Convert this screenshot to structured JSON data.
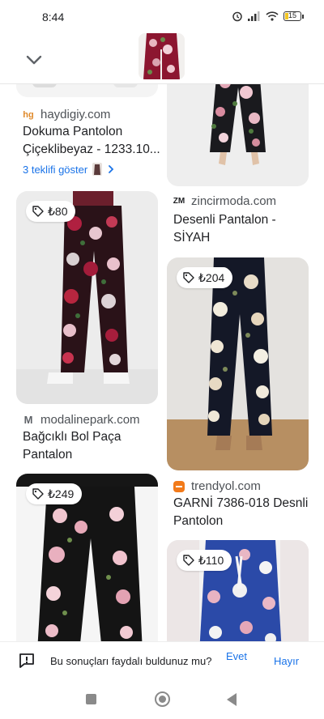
{
  "status_bar": {
    "time": "8:44",
    "battery": "15"
  },
  "header": {
    "back_icon": "chevron-down-icon"
  },
  "cards": [
    {
      "id": "haydigiy",
      "source": "haydigiy.com",
      "title": "Dokuma Pantolon Çiçeklibeyaz - 1233.10...",
      "offers": "3 teklifi göster"
    },
    {
      "id": "zincirmoda",
      "source": "zincirmoda.com",
      "title": "Desenli Pantalon - SİYAH"
    },
    {
      "id": "modalinepark",
      "price": "₺80",
      "source": "modalinepark.com",
      "title": "Bağcıklı Bol Paça Pantalon"
    },
    {
      "id": "trendyol204",
      "price": "₺204",
      "source": "trendyol.com",
      "title": "GARNİ 7386-018 Desnli Pantolon"
    },
    {
      "id": "card249",
      "price": "₺249"
    },
    {
      "id": "card110",
      "price": "₺110"
    }
  ],
  "feedback": {
    "question": "Bu sonuçları faydalı buldunuz mu?",
    "yes": "Evet",
    "no": "Hayır"
  },
  "colors": {
    "link": "#1a73e8",
    "text": "#202124",
    "muted": "#4d5156"
  }
}
